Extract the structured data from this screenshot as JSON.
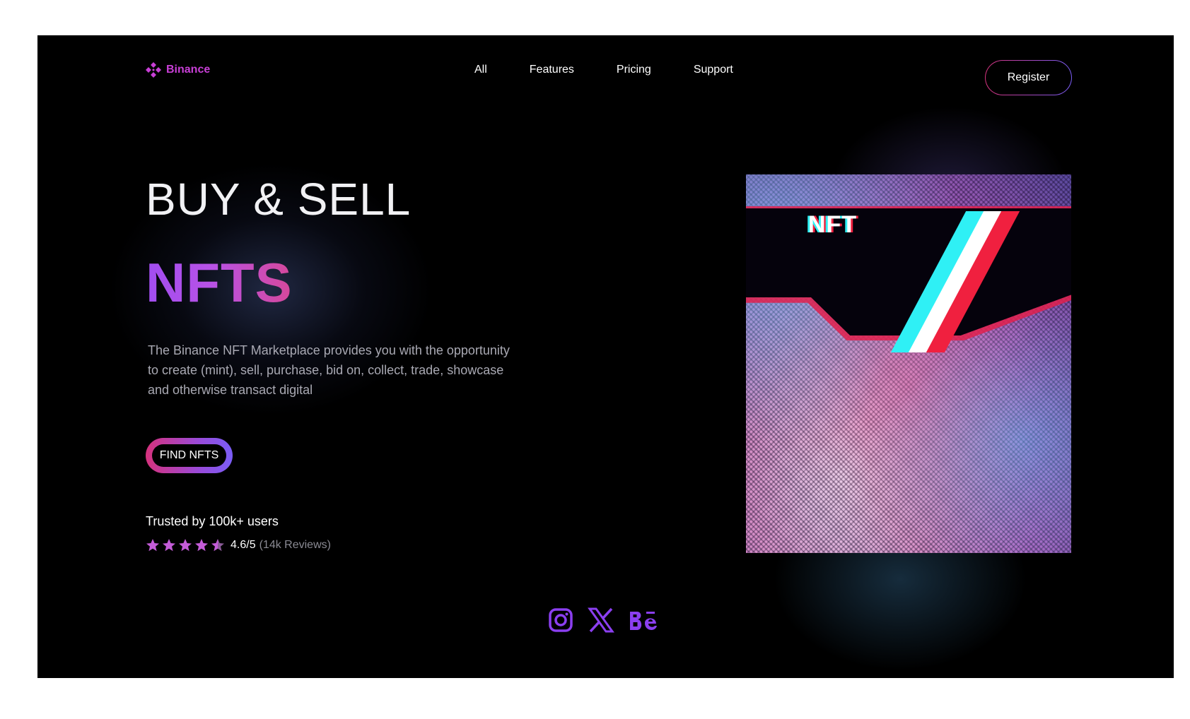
{
  "brand": {
    "name": "Binance",
    "color": "#c83fd6"
  },
  "nav": {
    "items": [
      {
        "label": "All"
      },
      {
        "label": "Features"
      },
      {
        "label": "Pricing"
      },
      {
        "label": "Support"
      }
    ],
    "register_label": "Register"
  },
  "hero": {
    "title_line1": "BUY & SELL",
    "title_line2": "NFTS",
    "description": "The Binance NFT Marketplace provides you with the opportunity to create (mint), sell, purchase, bid on, collect, trade, showcase and otherwise transact digital",
    "cta_label": "FIND NFTS",
    "trusted_text": "Trusted by 100k+ users",
    "rating": {
      "stars": 4.5,
      "max": 5,
      "score_text": "4.6/5",
      "reviews_text": "(14k Reviews)"
    }
  },
  "artwork": {
    "label": "NFT"
  },
  "social": {
    "icons": [
      "instagram-icon",
      "x-icon",
      "behance-icon"
    ],
    "color": "#8b3ff0"
  },
  "colors": {
    "accent_purple": "#a14df0",
    "accent_pink": "#d6327d",
    "accent_violet": "#7a5df6",
    "background": "#000000"
  }
}
